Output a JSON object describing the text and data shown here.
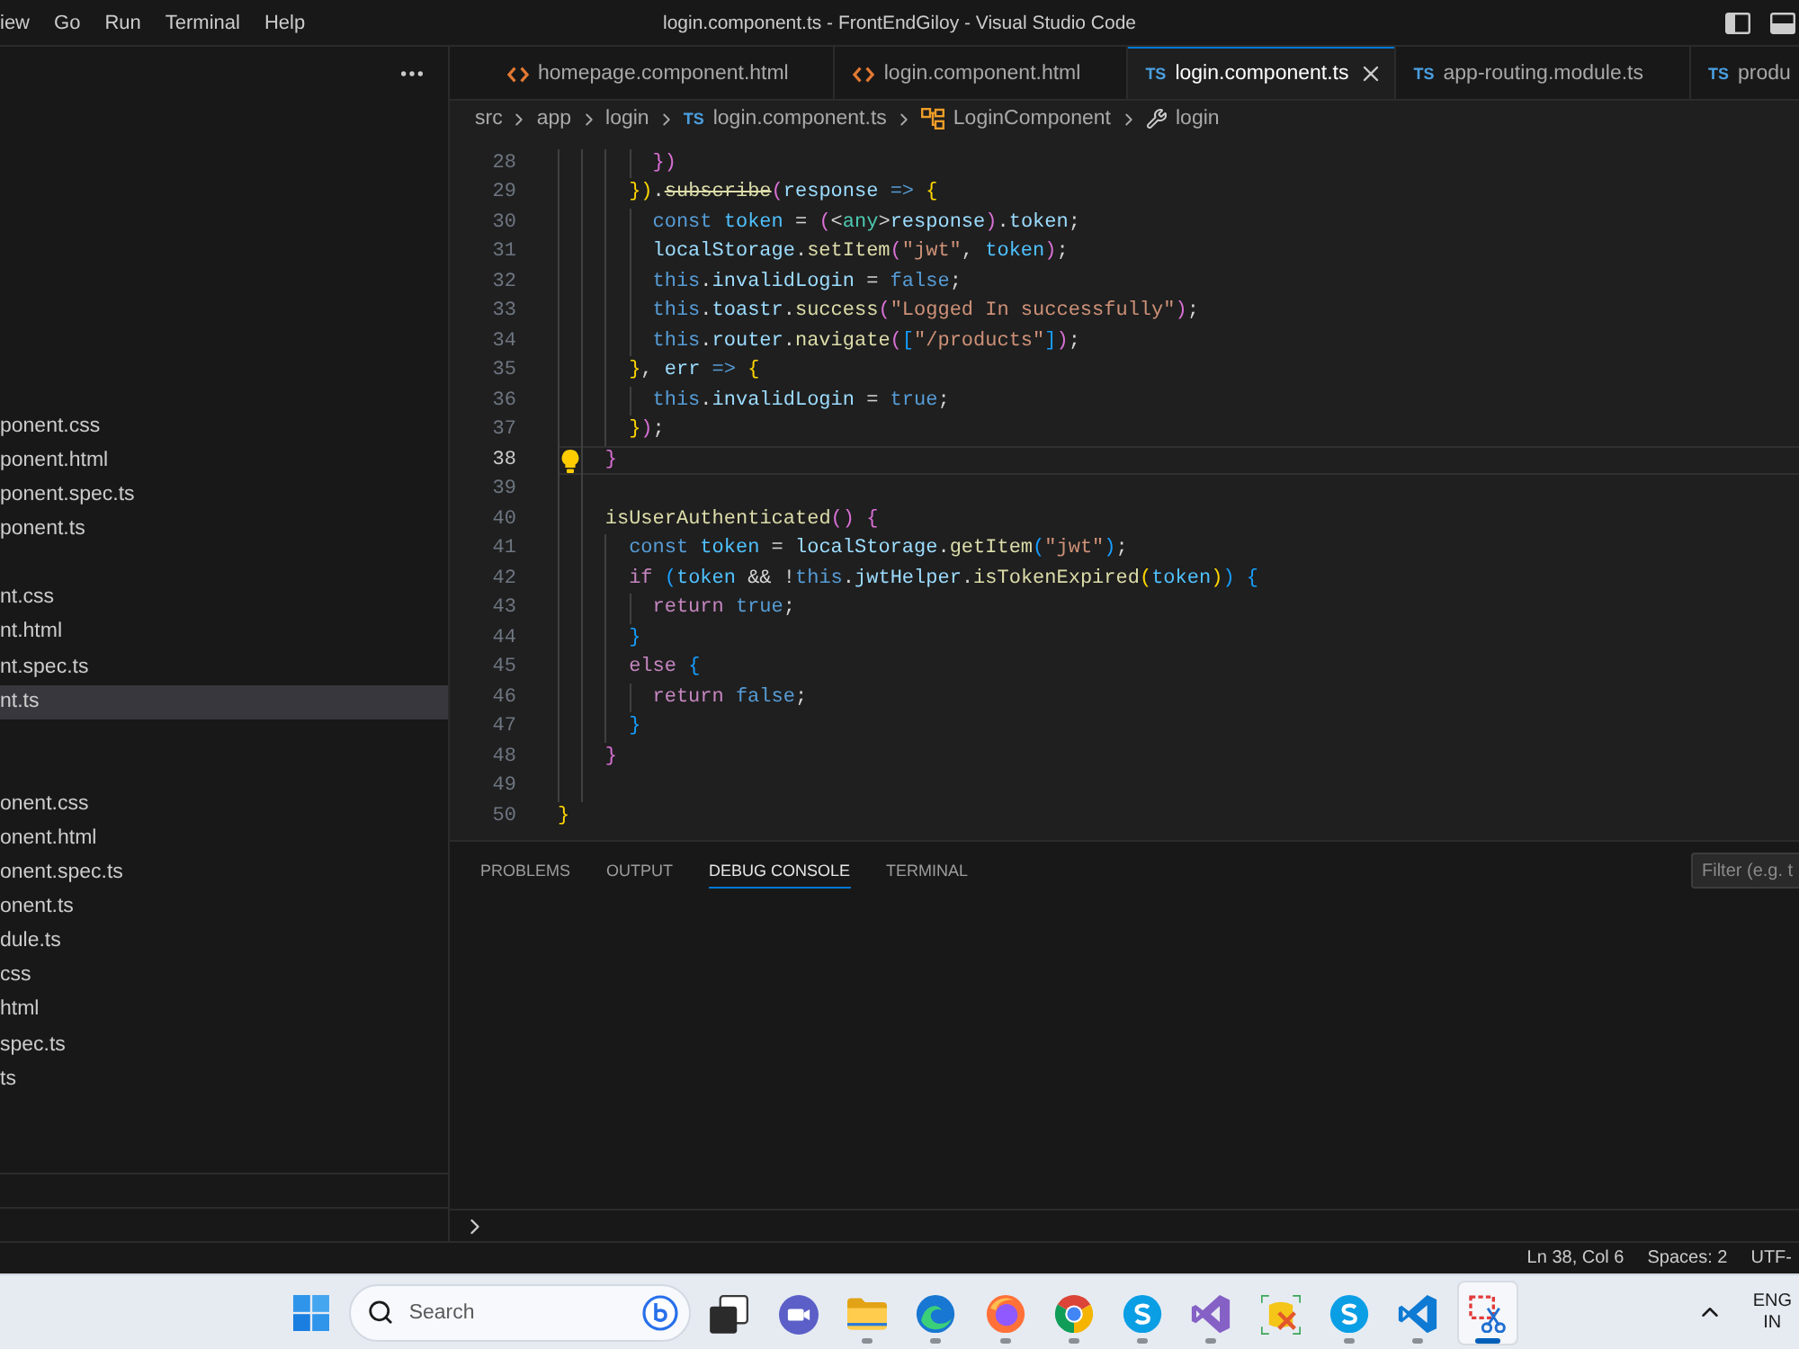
{
  "title_bar": {
    "menu": [
      "iew",
      "Go",
      "Run",
      "Terminal",
      "Help"
    ],
    "title": "login.component.ts - FrontEndGiloy - Visual Studio Code"
  },
  "sidebar": {
    "groups": [
      {
        "items": [
          {
            "label": "ponent.css",
            "selected": false
          },
          {
            "label": "ponent.html",
            "selected": false
          },
          {
            "label": "ponent.spec.ts",
            "selected": false
          },
          {
            "label": "ponent.ts",
            "selected": false
          }
        ]
      },
      {
        "items": [
          {
            "label": "nt.css",
            "selected": false
          },
          {
            "label": "nt.html",
            "selected": false
          },
          {
            "label": "nt.spec.ts",
            "selected": false
          },
          {
            "label": "nt.ts",
            "selected": true
          }
        ]
      },
      {
        "items": [
          {
            "label": "onent.css",
            "selected": false
          },
          {
            "label": "onent.html",
            "selected": false
          },
          {
            "label": "onent.spec.ts",
            "selected": false
          },
          {
            "label": "onent.ts",
            "selected": false
          },
          {
            "label": "dule.ts",
            "selected": false
          },
          {
            "label": "css",
            "selected": false
          },
          {
            "label": "html",
            "selected": false
          },
          {
            "label": "spec.ts",
            "selected": false
          },
          {
            "label": "ts",
            "selected": false
          }
        ]
      }
    ]
  },
  "tabs": [
    {
      "label": "homepage.component.html",
      "kind": "html",
      "selected": false
    },
    {
      "label": "login.component.html",
      "kind": "html",
      "selected": false
    },
    {
      "label": "login.component.ts",
      "kind": "ts",
      "badge": "TS",
      "selected": true
    },
    {
      "label": "app-routing.module.ts",
      "kind": "ts",
      "badge": "TS",
      "selected": false
    },
    {
      "label": "produ",
      "kind": "ts",
      "badge": "TS",
      "selected": false
    }
  ],
  "breadcrumbs": [
    {
      "label": "src",
      "kind": "folder"
    },
    {
      "label": "app",
      "kind": "folder"
    },
    {
      "label": "login",
      "kind": "folder"
    },
    {
      "label": "login.component.ts",
      "kind": "file",
      "badge": "TS"
    },
    {
      "label": "LoginComponent",
      "kind": "class"
    },
    {
      "label": "login",
      "kind": "method"
    }
  ],
  "editor": {
    "lines": [
      {
        "number": "28",
        "current": false,
        "tokens": [
          {
            "text": "        })",
            "kind": "bracket2"
          }
        ]
      },
      {
        "number": "29",
        "current": false,
        "tokens": [
          {
            "text": "      })",
            "kind": "bracket1"
          },
          {
            "text": ".",
            "kind": "plain"
          },
          {
            "text": "subscribe",
            "kind": "deprecated"
          },
          {
            "text": "(",
            "kind": "bracket2"
          },
          {
            "text": "response",
            "kind": "variable"
          },
          {
            "text": " => ",
            "kind": "keyword"
          },
          {
            "text": "{",
            "kind": "bracket1"
          }
        ]
      },
      {
        "number": "30",
        "current": false,
        "tokens": [
          {
            "text": "        const",
            "kind": "keyword"
          },
          {
            "text": " token",
            "kind": "constant"
          },
          {
            "text": " = ",
            "kind": "plain"
          },
          {
            "text": "(",
            "kind": "bracket2"
          },
          {
            "text": "<",
            "kind": "plain"
          },
          {
            "text": "any",
            "kind": "type"
          },
          {
            "text": ">",
            "kind": "plain"
          },
          {
            "text": "response",
            "kind": "variable"
          },
          {
            "text": ")",
            "kind": "bracket2"
          },
          {
            "text": ".",
            "kind": "plain"
          },
          {
            "text": "token",
            "kind": "variable"
          },
          {
            "text": ";",
            "kind": "plain"
          }
        ]
      },
      {
        "number": "31",
        "current": false,
        "tokens": [
          {
            "text": "        localStorage",
            "kind": "variable"
          },
          {
            "text": ".",
            "kind": "plain"
          },
          {
            "text": "setItem",
            "kind": "function"
          },
          {
            "text": "(",
            "kind": "bracket2"
          },
          {
            "text": "\"jwt\"",
            "kind": "string"
          },
          {
            "text": ", ",
            "kind": "plain"
          },
          {
            "text": "token",
            "kind": "constant"
          },
          {
            "text": ")",
            "kind": "bracket2"
          },
          {
            "text": ";",
            "kind": "plain"
          }
        ]
      },
      {
        "number": "32",
        "current": false,
        "tokens": [
          {
            "text": "        this",
            "kind": "keyword"
          },
          {
            "text": ".",
            "kind": "plain"
          },
          {
            "text": "invalidLogin",
            "kind": "variable"
          },
          {
            "text": " = ",
            "kind": "plain"
          },
          {
            "text": "false",
            "kind": "keyword"
          },
          {
            "text": ";",
            "kind": "plain"
          }
        ]
      },
      {
        "number": "33",
        "current": false,
        "tokens": [
          {
            "text": "        this",
            "kind": "keyword"
          },
          {
            "text": ".",
            "kind": "plain"
          },
          {
            "text": "toastr",
            "kind": "variable"
          },
          {
            "text": ".",
            "kind": "plain"
          },
          {
            "text": "success",
            "kind": "function"
          },
          {
            "text": "(",
            "kind": "bracket2"
          },
          {
            "text": "\"Logged In successfully\"",
            "kind": "string"
          },
          {
            "text": ")",
            "kind": "bracket2"
          },
          {
            "text": ";",
            "kind": "plain"
          }
        ]
      },
      {
        "number": "34",
        "current": false,
        "tokens": [
          {
            "text": "        this",
            "kind": "keyword"
          },
          {
            "text": ".",
            "kind": "plain"
          },
          {
            "text": "router",
            "kind": "variable"
          },
          {
            "text": ".",
            "kind": "plain"
          },
          {
            "text": "navigate",
            "kind": "function"
          },
          {
            "text": "(",
            "kind": "bracket2"
          },
          {
            "text": "[",
            "kind": "bracket3"
          },
          {
            "text": "\"/products\"",
            "kind": "string"
          },
          {
            "text": "]",
            "kind": "bracket3"
          },
          {
            "text": ")",
            "kind": "bracket2"
          },
          {
            "text": ";",
            "kind": "plain"
          }
        ]
      },
      {
        "number": "35",
        "current": false,
        "tokens": [
          {
            "text": "      }",
            "kind": "bracket1"
          },
          {
            "text": ", ",
            "kind": "plain"
          },
          {
            "text": "err",
            "kind": "variable"
          },
          {
            "text": " => ",
            "kind": "keyword"
          },
          {
            "text": "{",
            "kind": "bracket1"
          }
        ]
      },
      {
        "number": "36",
        "current": false,
        "tokens": [
          {
            "text": "        this",
            "kind": "keyword"
          },
          {
            "text": ".",
            "kind": "plain"
          },
          {
            "text": "invalidLogin",
            "kind": "variable"
          },
          {
            "text": " = ",
            "kind": "plain"
          },
          {
            "text": "true",
            "kind": "keyword"
          },
          {
            "text": ";",
            "kind": "plain"
          }
        ]
      },
      {
        "number": "37",
        "current": false,
        "tokens": [
          {
            "text": "      }",
            "kind": "bracket1"
          },
          {
            "text": ")",
            "kind": "bracket2"
          },
          {
            "text": ";",
            "kind": "plain"
          }
        ]
      },
      {
        "number": "38",
        "current": true,
        "tokens": [
          {
            "text": "    }",
            "kind": "bracket2"
          }
        ]
      },
      {
        "number": "39",
        "current": false
      },
      {
        "number": "40",
        "current": false,
        "tokens": [
          {
            "text": "    isUserAuthenticated",
            "kind": "function"
          },
          {
            "text": "() {",
            "kind": "bracket2"
          }
        ]
      },
      {
        "number": "41",
        "current": false,
        "tokens": [
          {
            "text": "      const",
            "kind": "keyword"
          },
          {
            "text": " token",
            "kind": "constant"
          },
          {
            "text": " = ",
            "kind": "plain"
          },
          {
            "text": "localStorage",
            "kind": "variable"
          },
          {
            "text": ".",
            "kind": "plain"
          },
          {
            "text": "getItem",
            "kind": "function"
          },
          {
            "text": "(",
            "kind": "bracket3"
          },
          {
            "text": "\"jwt\"",
            "kind": "string"
          },
          {
            "text": ")",
            "kind": "bracket3"
          },
          {
            "text": ";",
            "kind": "plain"
          }
        ]
      },
      {
        "number": "42",
        "current": false,
        "tokens": [
          {
            "text": "      if",
            "kind": "control"
          },
          {
            "text": " (",
            "kind": "bracket3"
          },
          {
            "text": "token",
            "kind": "constant"
          },
          {
            "text": " && !",
            "kind": "plain"
          },
          {
            "text": "this",
            "kind": "keyword"
          },
          {
            "text": ".",
            "kind": "plain"
          },
          {
            "text": "jwtHelper",
            "kind": "variable"
          },
          {
            "text": ".",
            "kind": "plain"
          },
          {
            "text": "isTokenExpired",
            "kind": "function"
          },
          {
            "text": "(",
            "kind": "bracket1"
          },
          {
            "text": "token",
            "kind": "constant"
          },
          {
            "text": ")",
            "kind": "bracket1"
          },
          {
            "text": ")",
            "kind": "bracket3"
          },
          {
            "text": " {",
            "kind": "bracket3"
          }
        ]
      },
      {
        "number": "43",
        "current": false,
        "tokens": [
          {
            "text": "        return",
            "kind": "control"
          },
          {
            "text": " true",
            "kind": "keyword"
          },
          {
            "text": ";",
            "kind": "plain"
          }
        ]
      },
      {
        "number": "44",
        "current": false,
        "tokens": [
          {
            "text": "      }",
            "kind": "bracket3"
          }
        ]
      },
      {
        "number": "45",
        "current": false,
        "tokens": [
          {
            "text": "      else",
            "kind": "control"
          },
          {
            "text": " {",
            "kind": "bracket3"
          }
        ]
      },
      {
        "number": "46",
        "current": false,
        "tokens": [
          {
            "text": "        return",
            "kind": "control"
          },
          {
            "text": " false",
            "kind": "keyword"
          },
          {
            "text": ";",
            "kind": "plain"
          }
        ]
      },
      {
        "number": "47",
        "current": false,
        "tokens": [
          {
            "text": "      }",
            "kind": "bracket3"
          }
        ]
      },
      {
        "number": "48",
        "current": false,
        "tokens": [
          {
            "text": "    }",
            "kind": "bracket2"
          }
        ]
      },
      {
        "number": "49",
        "current": false
      },
      {
        "number": "50",
        "current": false,
        "tokens": [
          {
            "text": "}",
            "kind": "bracket1"
          }
        ]
      }
    ]
  },
  "panel": {
    "tabs": [
      {
        "label": "PROBLEMS",
        "selected": false
      },
      {
        "label": "OUTPUT",
        "selected": false
      },
      {
        "label": "DEBUG CONSOLE",
        "selected": true
      },
      {
        "label": "TERMINAL",
        "selected": false
      }
    ],
    "filter": {
      "placeholder": "Filter (e.g. t"
    }
  },
  "status_bar": [
    "Ln 38, Col 6",
    "Spaces: 2",
    "UTF-"
  ],
  "taskbar": {
    "search": {
      "placeholder": "Search"
    },
    "apps": [
      {
        "kind": "taskview",
        "running": false,
        "active": false
      },
      {
        "kind": "chat",
        "running": false,
        "active": false
      },
      {
        "kind": "explorer",
        "running": true,
        "active": false
      },
      {
        "kind": "edge",
        "running": true,
        "active": false
      },
      {
        "kind": "firefox",
        "running": true,
        "active": false
      },
      {
        "kind": "chrome",
        "running": true,
        "active": false
      },
      {
        "kind": "skype",
        "running": true,
        "active": false
      },
      {
        "kind": "visualstudio",
        "running": true,
        "active": false
      },
      {
        "kind": "dbtool",
        "running": false,
        "active": false
      },
      {
        "kind": "skype",
        "running": true,
        "active": false
      },
      {
        "kind": "vscode",
        "running": true,
        "active": false
      },
      {
        "kind": "snip",
        "running": true,
        "active": true
      }
    ],
    "language": "ENG",
    "region": "IN"
  }
}
